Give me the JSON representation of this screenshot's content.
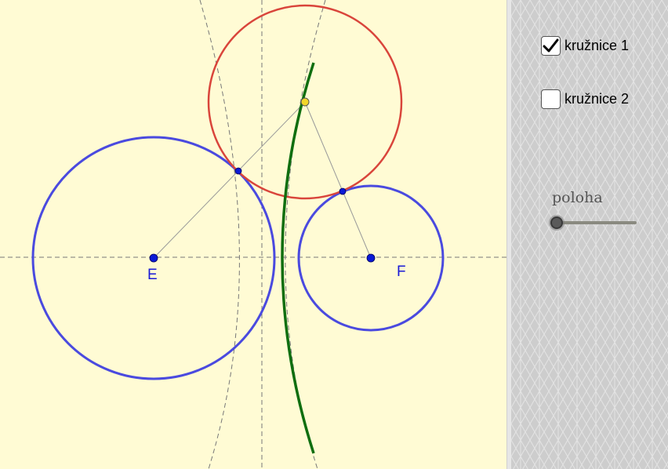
{
  "canvas": {
    "background": "#fffbd4",
    "point_labels": {
      "e": "E",
      "f": "F"
    },
    "colors": {
      "blue": "#4a4adf",
      "red": "#d9453b",
      "green": "#0f6e0f",
      "point_blue": "#0a1ad6",
      "point_yellow": "#f2d62a",
      "dashed": "#777777"
    }
  },
  "panel": {
    "checkboxes": [
      {
        "label": "kružnice 1",
        "checked": true
      },
      {
        "label": "kružnice 2",
        "checked": false
      }
    ],
    "slider": {
      "label": "poloha",
      "value": 0
    }
  }
}
